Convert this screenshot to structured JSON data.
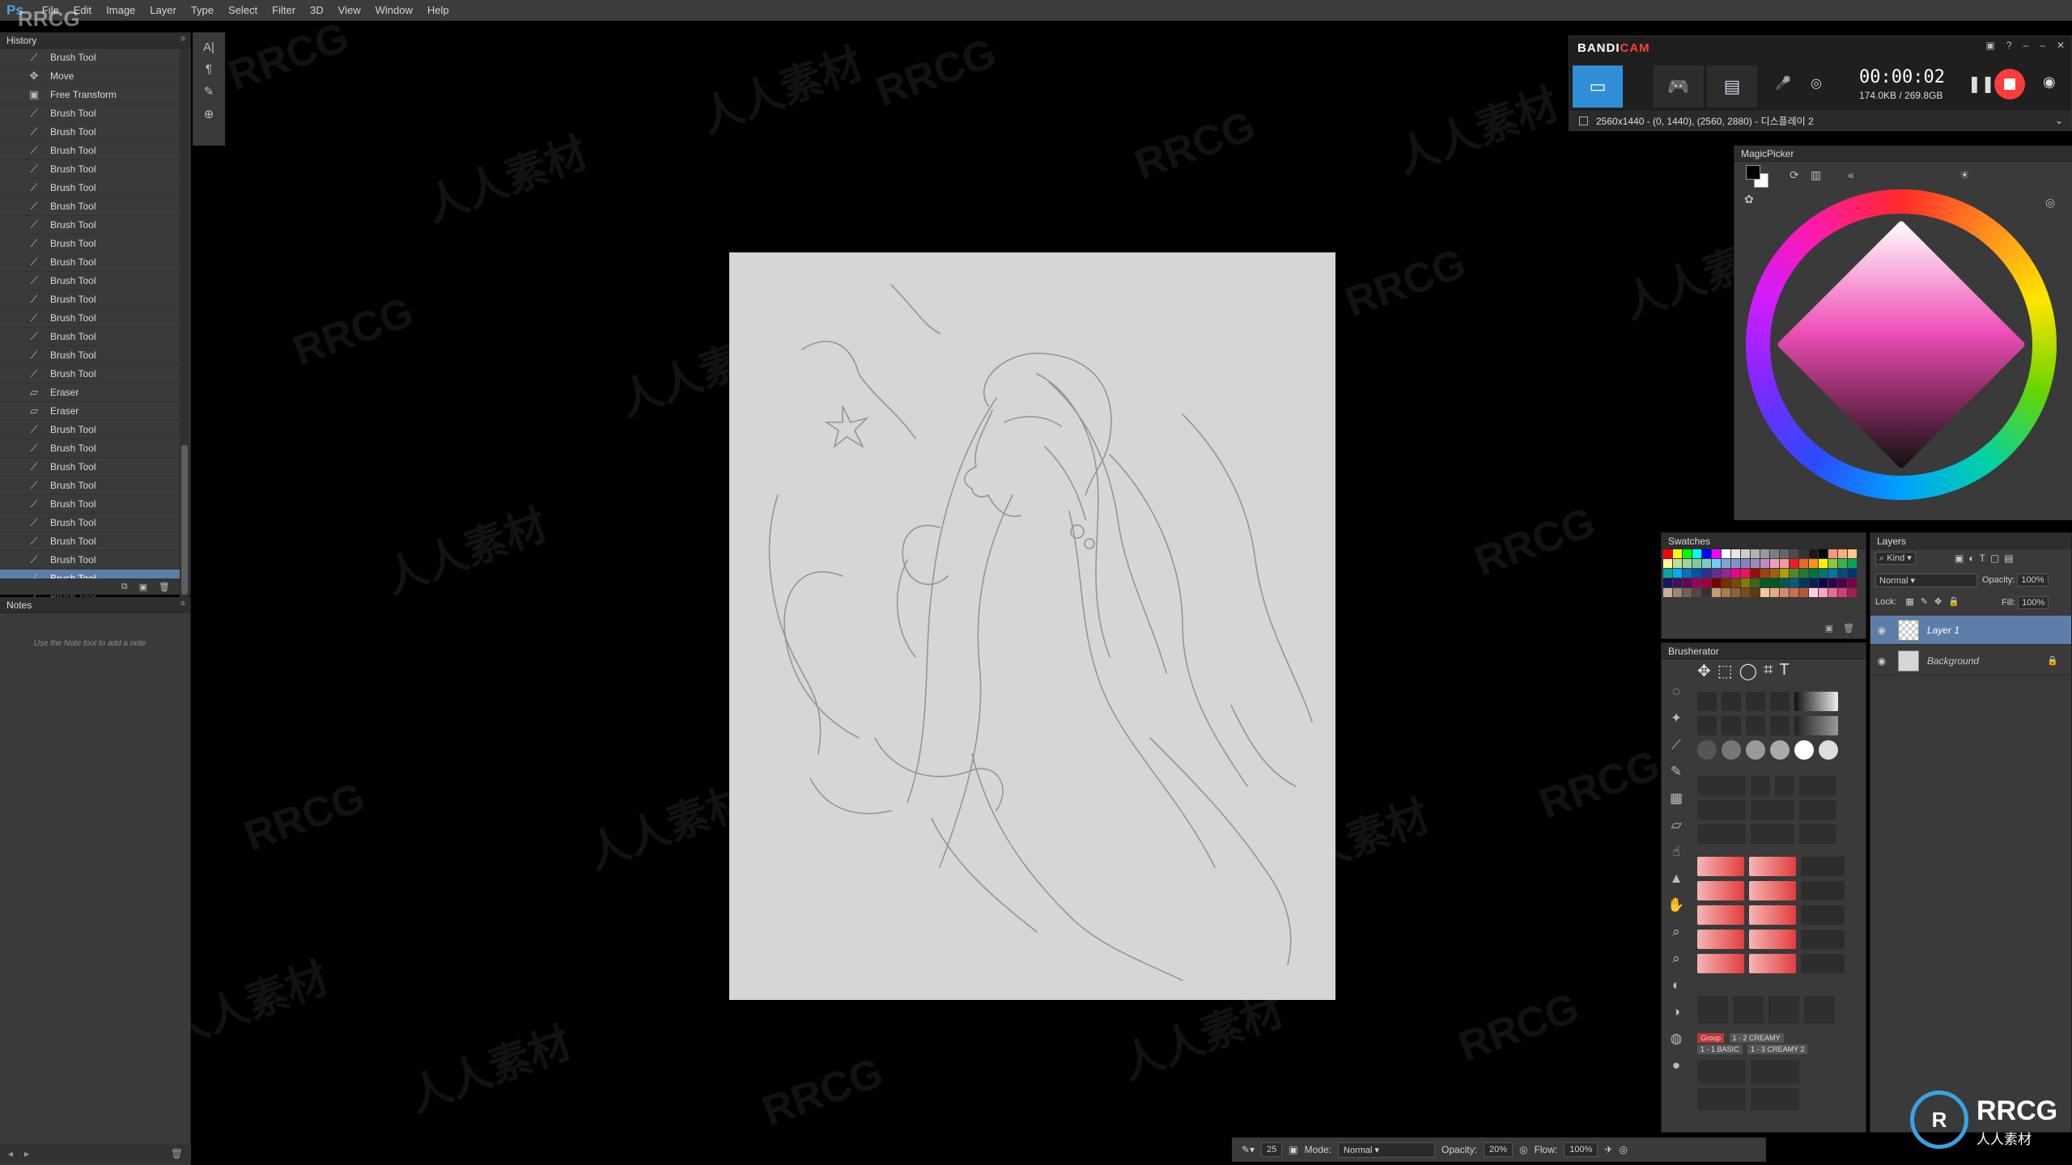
{
  "app": {
    "logo": "Ps",
    "menu": [
      "File",
      "Edit",
      "Image",
      "Layer",
      "Type",
      "Select",
      "Filter",
      "3D",
      "View",
      "Window",
      "Help"
    ]
  },
  "history": {
    "title": "History",
    "items": [
      {
        "label": "Brush Tool",
        "icon": "brush-icon",
        "state": "normal"
      },
      {
        "label": "Move",
        "icon": "move-icon",
        "state": "normal"
      },
      {
        "label": "Free Transform",
        "icon": "transform-icon",
        "state": "normal"
      },
      {
        "label": "Brush Tool",
        "icon": "brush-icon",
        "state": "normal"
      },
      {
        "label": "Brush Tool",
        "icon": "brush-icon",
        "state": "normal"
      },
      {
        "label": "Brush Tool",
        "icon": "brush-icon",
        "state": "normal"
      },
      {
        "label": "Brush Tool",
        "icon": "brush-icon",
        "state": "normal"
      },
      {
        "label": "Brush Tool",
        "icon": "brush-icon",
        "state": "normal"
      },
      {
        "label": "Brush Tool",
        "icon": "brush-icon",
        "state": "normal"
      },
      {
        "label": "Brush Tool",
        "icon": "brush-icon",
        "state": "normal"
      },
      {
        "label": "Brush Tool",
        "icon": "brush-icon",
        "state": "normal"
      },
      {
        "label": "Brush Tool",
        "icon": "brush-icon",
        "state": "normal"
      },
      {
        "label": "Brush Tool",
        "icon": "brush-icon",
        "state": "normal"
      },
      {
        "label": "Brush Tool",
        "icon": "brush-icon",
        "state": "normal"
      },
      {
        "label": "Brush Tool",
        "icon": "brush-icon",
        "state": "normal"
      },
      {
        "label": "Brush Tool",
        "icon": "brush-icon",
        "state": "normal"
      },
      {
        "label": "Brush Tool",
        "icon": "brush-icon",
        "state": "normal"
      },
      {
        "label": "Brush Tool",
        "icon": "brush-icon",
        "state": "normal"
      },
      {
        "label": "Eraser",
        "icon": "eraser-icon",
        "state": "normal"
      },
      {
        "label": "Eraser",
        "icon": "eraser-icon",
        "state": "normal"
      },
      {
        "label": "Brush Tool",
        "icon": "brush-icon",
        "state": "normal"
      },
      {
        "label": "Brush Tool",
        "icon": "brush-icon",
        "state": "normal"
      },
      {
        "label": "Brush Tool",
        "icon": "brush-icon",
        "state": "normal"
      },
      {
        "label": "Brush Tool",
        "icon": "brush-icon",
        "state": "normal"
      },
      {
        "label": "Brush Tool",
        "icon": "brush-icon",
        "state": "normal"
      },
      {
        "label": "Brush Tool",
        "icon": "brush-icon",
        "state": "normal"
      },
      {
        "label": "Brush Tool",
        "icon": "brush-icon",
        "state": "normal"
      },
      {
        "label": "Brush Tool",
        "icon": "brush-icon",
        "state": "normal"
      },
      {
        "label": "Brush Tool",
        "icon": "brush-icon",
        "state": "active"
      },
      {
        "label": "Brush Tool",
        "icon": "brush-icon",
        "state": "faded"
      }
    ]
  },
  "notes": {
    "title": "Notes",
    "hint": "Use the Note tool to add a note"
  },
  "bandicam": {
    "title_a": "BANDI",
    "title_b": "CAM",
    "timer": "00:00:02",
    "size": "174.0KB / 269.8GB",
    "area": "2560x1440 - (0, 1440), (2560, 2880) - 디스플레이 2"
  },
  "magicpicker": {
    "title": "MagicPicker"
  },
  "swatches": {
    "title": "Swatches",
    "colors": [
      "#ff0000",
      "#ffff00",
      "#00ff00",
      "#00ffff",
      "#0000ff",
      "#ff00ff",
      "#ffffff",
      "#e6e6e6",
      "#cccccc",
      "#b3b3b3",
      "#999999",
      "#808080",
      "#666666",
      "#4d4d4d",
      "#333333",
      "#1a1a1a",
      "#000000",
      "#f7977a",
      "#f9ad81",
      "#fdc68a",
      "#fff79a",
      "#c4df9b",
      "#a3d39c",
      "#82ca9d",
      "#7bcdc8",
      "#6ecff6",
      "#7ea7d8",
      "#8493ca",
      "#8882be",
      "#a187be",
      "#bc8dbf",
      "#f49ac2",
      "#f6989d",
      "#ed1c24",
      "#f26522",
      "#f7941d",
      "#fff200",
      "#8dc63f",
      "#39b54a",
      "#00a651",
      "#00a99d",
      "#00aeef",
      "#0072bc",
      "#0054a6",
      "#2e3192",
      "#662d91",
      "#92278f",
      "#ec008c",
      "#ed145b",
      "#9e0b0f",
      "#a0410d",
      "#a36209",
      "#aba000",
      "#598527",
      "#1a7b30",
      "#007236",
      "#00746b",
      "#0076a3",
      "#004b80",
      "#003471",
      "#1b1464",
      "#440e62",
      "#630460",
      "#9e005d",
      "#9e0039",
      "#790000",
      "#7b2e00",
      "#7d4900",
      "#827b00",
      "#406618",
      "#005e20",
      "#005826",
      "#005952",
      "#005b7f",
      "#003663",
      "#002157",
      "#0d004c",
      "#32004b",
      "#4b0049",
      "#7b0046",
      "#c7b299",
      "#998675",
      "#736357",
      "#534741",
      "#37302d",
      "#c69c6d",
      "#a67c52",
      "#8c6239",
      "#754c24",
      "#603913",
      "#f5c6a5",
      "#e8a885",
      "#d98a6a",
      "#c96f4f",
      "#b55637",
      "#ffd1dc",
      "#f8a5c2",
      "#e66b9a",
      "#cf3f75",
      "#a11d55"
    ]
  },
  "brusherator": {
    "title": "Brusherator",
    "group_tags": [
      "Group",
      "1 - 2 CREAMY",
      "1 - 1 BASIC",
      "1 - 3 CREAMY 2"
    ]
  },
  "layers": {
    "title": "Layers",
    "filter": "Kind",
    "blend_mode": "Normal",
    "opacity_label": "Opacity:",
    "opacity": "100%",
    "lock_label": "Lock:",
    "fill_label": "Fill:",
    "fill": "100%",
    "items": [
      {
        "name": "Layer 1",
        "active": true
      },
      {
        "name": "Background",
        "active": false
      }
    ]
  },
  "options": {
    "brush_size": "25",
    "mode_label": "Mode:",
    "mode": "Normal",
    "opacity_label": "Opacity:",
    "opacity": "20%",
    "flow_label": "Flow:",
    "flow": "100%"
  },
  "watermark": {
    "latin": "RRCG",
    "cjk": "人人素材",
    "logo_text": "RRCG",
    "logo_sub": "人人素材"
  }
}
